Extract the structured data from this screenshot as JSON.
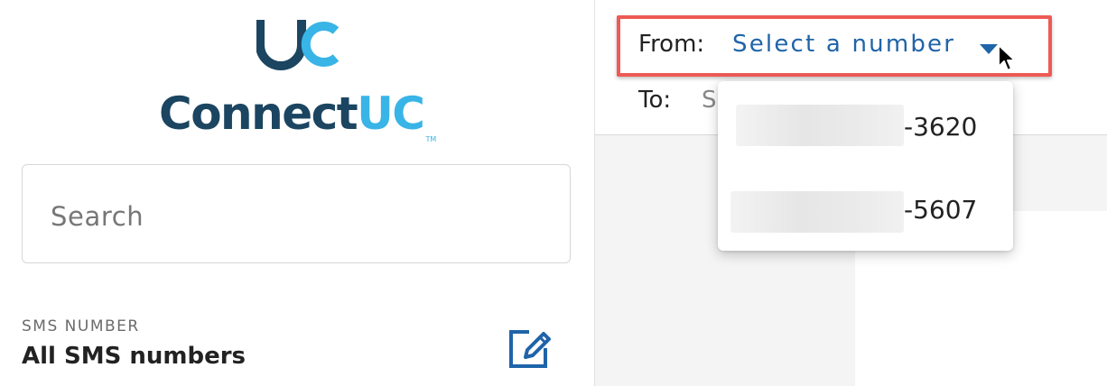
{
  "brand": {
    "name_part1": "Connect",
    "name_part2": "UC",
    "trademark": "TM",
    "colors": {
      "navy": "#1b4561",
      "sky": "#39b4e6"
    }
  },
  "sidebar": {
    "search_placeholder": "Search",
    "sms_caption": "SMS NUMBER",
    "sms_value": "All SMS numbers",
    "edit_icon": "edit-icon"
  },
  "compose": {
    "from_label": "From:",
    "from_value": "Select a number",
    "to_label": "To:",
    "to_value_visible": "S"
  },
  "dropdown": {
    "options": [
      {
        "suffix": "-3620"
      },
      {
        "suffix": "-5607"
      }
    ]
  },
  "colors": {
    "link_blue": "#1f64a8",
    "highlight_red": "#ee5a55"
  }
}
